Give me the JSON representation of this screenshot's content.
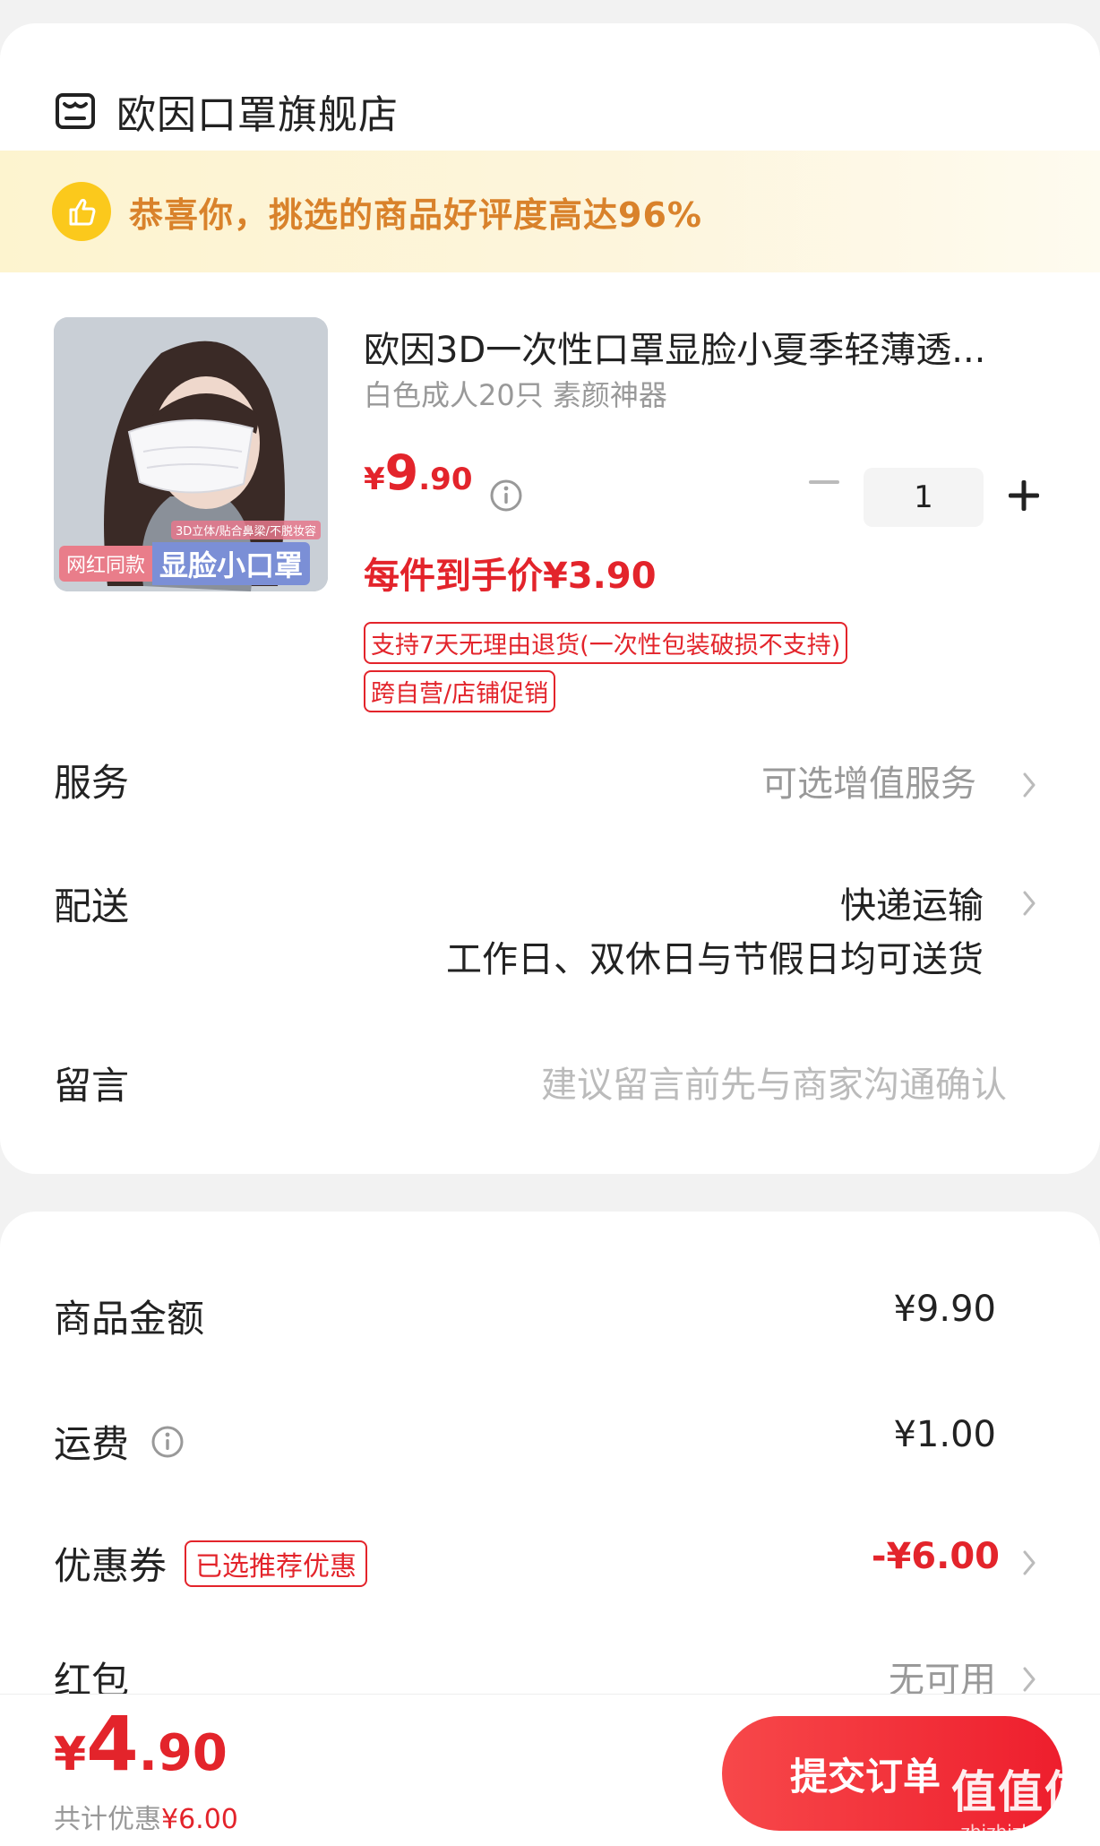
{
  "store": {
    "name": "欧因口罩旗舰店",
    "icon": "store-icon"
  },
  "banner": {
    "text": "恭喜你，挑选的商品好评度高达96%",
    "icon": "thumbs-up-icon",
    "color": "#d9822b"
  },
  "product": {
    "title": "欧因3D一次性口罩显脸小夏季轻薄透...",
    "spec": "白色成人20只 素颜神器",
    "price_currency": "¥",
    "price_integer": "9",
    "price_decimal": ".90",
    "quantity": "1",
    "unit_price": "每件到手价¥3.90",
    "tags": [
      "支持7天无理由退货(一次性包装破损不支持)",
      "跨自营/店铺促销"
    ],
    "image": {
      "tag_a": "网红同款",
      "tag_b": "显脸小口罩",
      "tag_small": "3D立体/贴合鼻梁/不脱妆容"
    }
  },
  "options": {
    "service": {
      "label": "服务",
      "value": "可选增值服务"
    },
    "delivery": {
      "label": "配送",
      "value": "快递运输",
      "sub": "工作日、双休日与节假日均可送货"
    },
    "message": {
      "label": "留言",
      "placeholder": "建议留言前先与商家沟通确认"
    }
  },
  "summary": {
    "goods_amount": {
      "label": "商品金额",
      "value": "¥9.90"
    },
    "shipping": {
      "label": "运费",
      "value": "¥1.00"
    },
    "coupon": {
      "label": "优惠券",
      "badge": "已选推荐优惠",
      "value": "-¥6.00"
    },
    "red_packet": {
      "label": "红包",
      "value": "无可用"
    }
  },
  "footer": {
    "total_currency": "¥",
    "total_integer": "4",
    "total_decimal": ".90",
    "saving_label": "共计优惠",
    "saving_amount": "¥6.00",
    "submit_label": "提交订单"
  },
  "watermark": {
    "big": "值值值",
    "small": "zhizhizhi.com"
  },
  "colors": {
    "accent_red": "#e3242b",
    "banner_gold": "#fbc91c",
    "background": "#f2f2f2"
  }
}
